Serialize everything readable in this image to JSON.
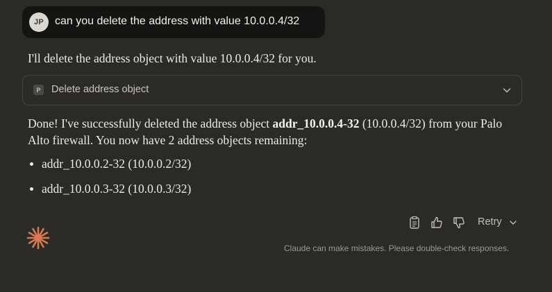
{
  "user_message": {
    "avatar_initials": "JP",
    "text": "can you delete the address with value 10.0.0.4/32"
  },
  "assistant": {
    "intro": "I'll delete the address object with value 10.0.0.4/32 for you.",
    "tool_call": {
      "icon_letter": "P",
      "label": "Delete address object",
      "expanded": false
    },
    "response": {
      "part1": "Done! I've successfully deleted the address object ",
      "bold": "addr_10.0.0.4-32",
      "part2": " (10.0.0.4/32) from your Palo Alto firewall. You now have 2 address objects remaining:"
    },
    "bullets": [
      "addr_10.0.0.2-32 (10.0.0.2/32)",
      "addr_10.0.0.3-32 (10.0.0.3/32)"
    ]
  },
  "actions": {
    "copy_icon": "clipboard-icon",
    "thumbs_up_icon": "thumbs-up-icon",
    "thumbs_down_icon": "thumbs-down-icon",
    "retry_label": "Retry"
  },
  "footer": {
    "disclaimer": "Claude can make mistakes. Please double-check responses."
  },
  "colors": {
    "background": "#2b2a27",
    "user_bubble": "#141413",
    "accent_logo": "#d97757",
    "text_primary": "#ecebe6",
    "text_muted": "#9c9a92"
  }
}
